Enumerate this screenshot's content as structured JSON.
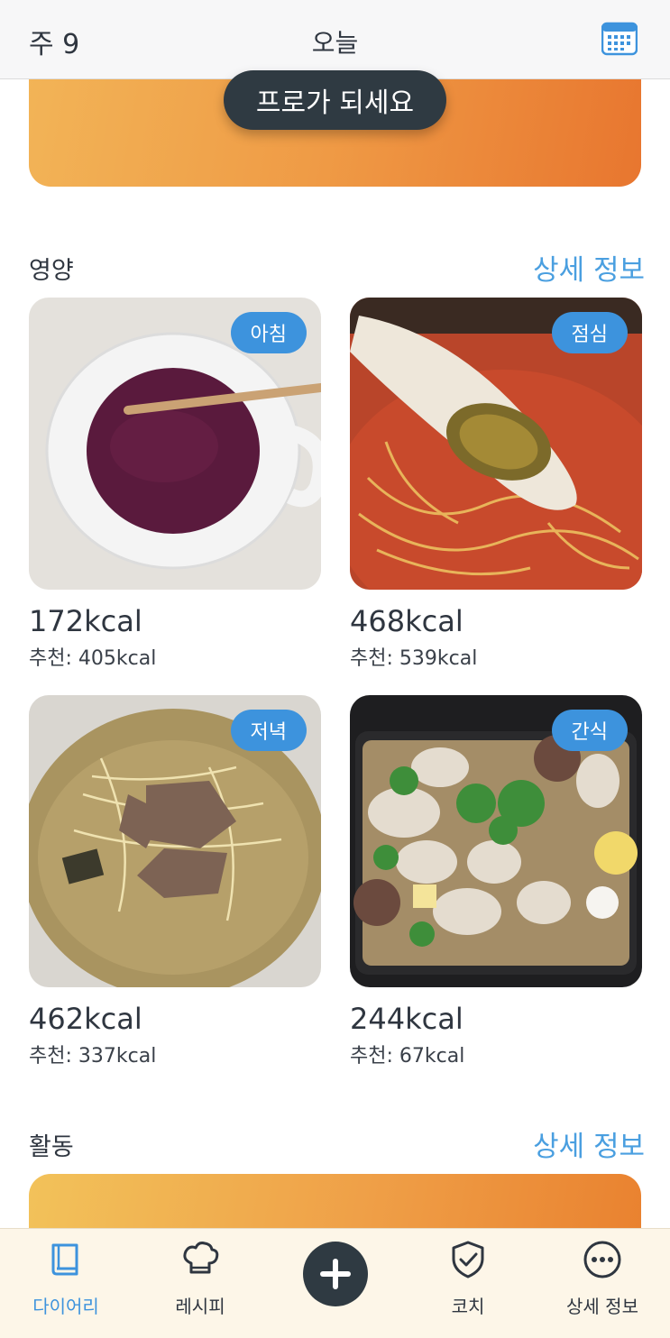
{
  "header": {
    "week": "주 9",
    "title": "오늘"
  },
  "banner": {
    "button": "프로가 되세요"
  },
  "nutrition": {
    "title": "영양",
    "link": "상세 정보",
    "meals": [
      {
        "badge": "아침",
        "kcal": "172kcal",
        "recommended": "추천: 405kcal"
      },
      {
        "badge": "점심",
        "kcal": "468kcal",
        "recommended": "추천: 539kcal"
      },
      {
        "badge": "저녁",
        "kcal": "462kcal",
        "recommended": "추천: 337kcal"
      },
      {
        "badge": "간식",
        "kcal": "244kcal",
        "recommended": "추천: 67kcal"
      }
    ]
  },
  "activity": {
    "title": "활동",
    "link": "상세 정보"
  },
  "tabbar": {
    "diary": "다이어리",
    "recipes": "레시피",
    "coach": "코치",
    "more": "상세 정보"
  },
  "colors": {
    "accent": "#3d93dd",
    "dark": "#2f3a42",
    "orange": "#ef9a45"
  }
}
